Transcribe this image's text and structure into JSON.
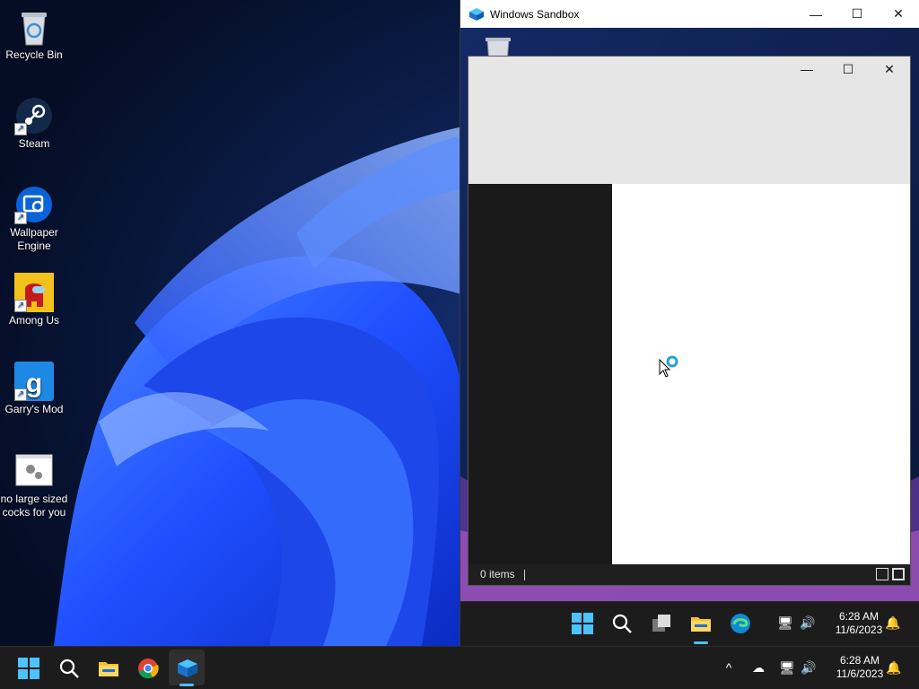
{
  "desktop": {
    "icons": [
      {
        "label": "Recycle Bin",
        "icon": "recycle-bin-icon"
      },
      {
        "label": "Steam",
        "icon": "steam-icon"
      },
      {
        "label": "Wallpaper Engine",
        "icon": "wallpaper-engine-icon"
      },
      {
        "label": "Among Us",
        "icon": "among-us-icon"
      },
      {
        "label": "Garry's Mod",
        "icon": "garrys-mod-icon"
      },
      {
        "label": "no large sized cocks for you",
        "icon": "settings-file-icon"
      }
    ]
  },
  "sandbox": {
    "title": "Windows Sandbox",
    "controls": {
      "minimize": "—",
      "maximize": "☐",
      "close": "✕"
    },
    "explorer": {
      "status_text": "0 items",
      "controls": {
        "minimize": "—",
        "maximize": "☐",
        "close": "✕"
      }
    },
    "taskbar": {
      "time": "6:28 AM",
      "date": "11/6/2023"
    }
  },
  "taskbar": {
    "apps": [
      "start-icon",
      "search-icon",
      "file-explorer-icon",
      "chrome-icon",
      "windows-sandbox-icon"
    ],
    "time": "6:28 AM",
    "date": "11/6/2023",
    "tray_overflow": "^"
  },
  "colors": {
    "accent": "#4cc2ff",
    "wallpaper_blue": "#1f5bff",
    "titlebar": "#ffffff"
  }
}
